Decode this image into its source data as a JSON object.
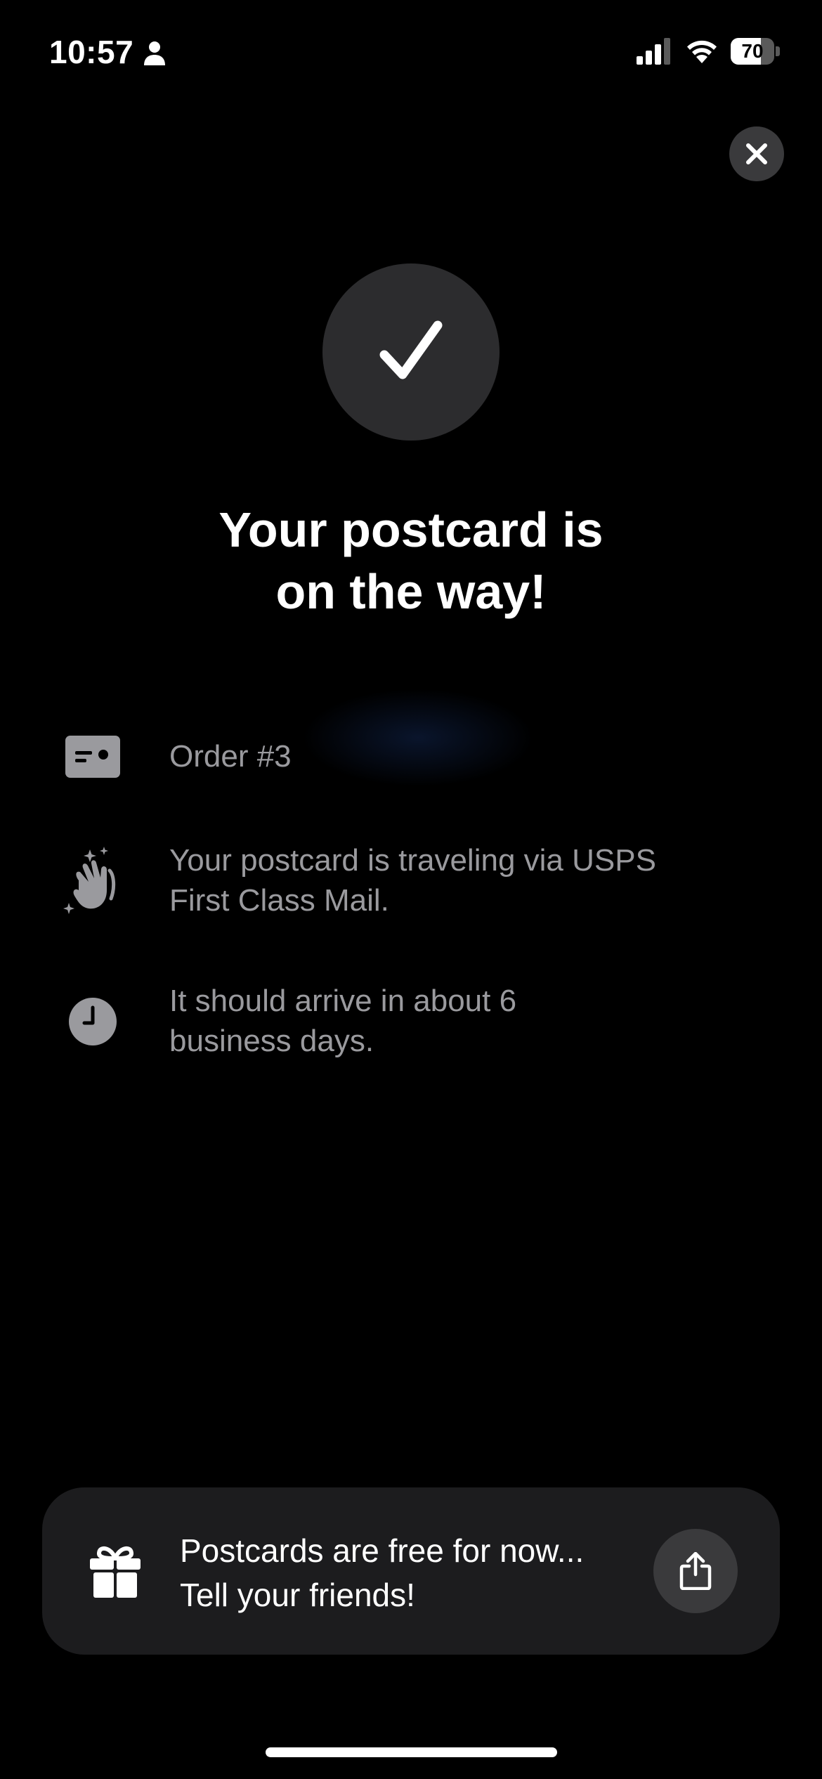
{
  "status_bar": {
    "time": "10:57",
    "battery_level": "70",
    "battery_fraction": 0.7
  },
  "header": {
    "close_icon": "close-icon"
  },
  "confirmation": {
    "icon": "checkmark-icon",
    "title_line1": "Your postcard is",
    "title_line2": "on the way!"
  },
  "details": [
    {
      "icon": "id-card-icon",
      "text": "Order #3"
    },
    {
      "icon": "clapping-hands-icon",
      "text_line1": "Your postcard is traveling via USPS",
      "text_line2": "First Class Mail."
    },
    {
      "icon": "clock-icon",
      "text_line1": "It should arrive in about 6",
      "text_line2": "business days."
    }
  ],
  "promo": {
    "icon": "gift-icon",
    "line1": "Postcards are free for now...",
    "line2": "Tell your friends!",
    "share_icon": "share-icon"
  },
  "colors": {
    "background": "#000000",
    "card": "#1c1c1e",
    "circle": "#2c2c2e",
    "secondary_text": "#9a9a9e"
  }
}
